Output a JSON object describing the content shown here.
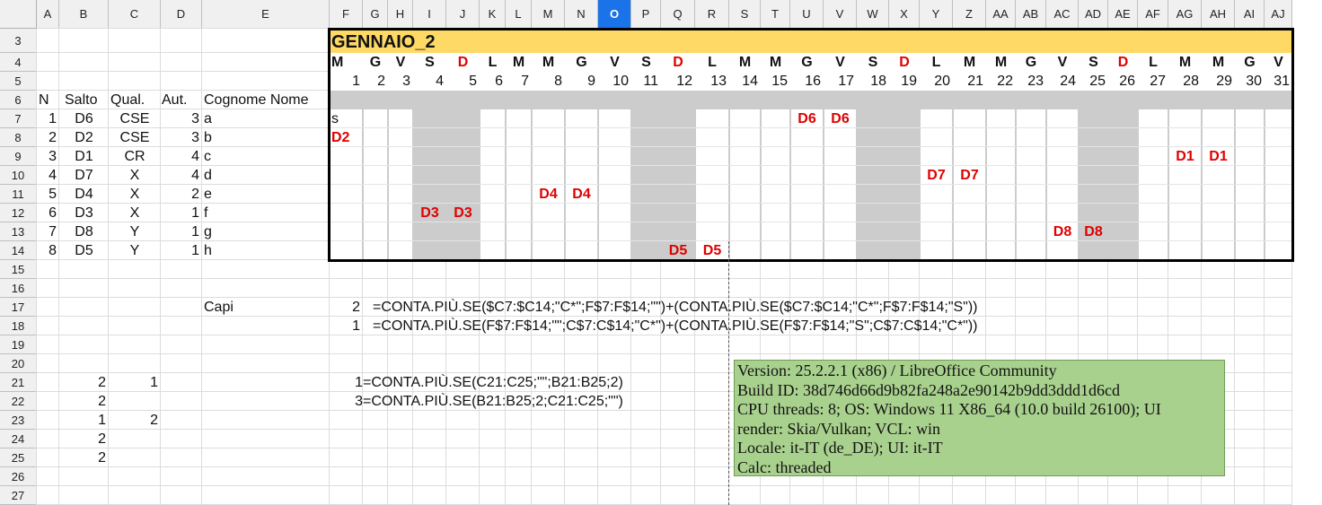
{
  "columns": [
    "A",
    "B",
    "C",
    "D",
    "E",
    "F",
    "G",
    "H",
    "I",
    "J",
    "K",
    "L",
    "M",
    "N",
    "O",
    "P",
    "Q",
    "R",
    "S",
    "T",
    "U",
    "V",
    "W",
    "X",
    "Y",
    "Z",
    "AA",
    "AB",
    "AC",
    "AD",
    "AE",
    "AF",
    "AG",
    "AH",
    "AI",
    "AJ"
  ],
  "selected_column": "O",
  "rows": [
    "3",
    "4",
    "5",
    "6",
    "7",
    "8",
    "9",
    "10",
    "11",
    "12",
    "13",
    "14",
    "15",
    "16",
    "17",
    "18",
    "19",
    "20",
    "21",
    "22",
    "23",
    "24",
    "25",
    "26",
    "27"
  ],
  "calendar": {
    "title": "GENNAIO_2",
    "weekdays": [
      "M",
      "G",
      "V",
      "S",
      "D",
      "L",
      "M",
      "M",
      "G",
      "V",
      "S",
      "D",
      "L",
      "M",
      "M",
      "G",
      "V",
      "S",
      "D",
      "L",
      "M",
      "M",
      "G",
      "V",
      "S",
      "D",
      "L",
      "M",
      "M",
      "G",
      "V"
    ],
    "days": [
      "1",
      "2",
      "3",
      "4",
      "5",
      "6",
      "7",
      "8",
      "9",
      "10",
      "11",
      "12",
      "13",
      "14",
      "15",
      "16",
      "17",
      "18",
      "19",
      "20",
      "21",
      "22",
      "23",
      "24",
      "25",
      "26",
      "27",
      "28",
      "29",
      "30",
      "31"
    ],
    "sunday_color": "#e00000",
    "header_color": "#ffd966",
    "band_color": "#cccccc"
  },
  "table": {
    "headers": {
      "n": "N",
      "salto": "Salto",
      "qual": "Qual.",
      "aut": "Aut.",
      "name": "Cognome Nome"
    },
    "rows": [
      {
        "n": "1",
        "salto": "D6",
        "qual": "CSE",
        "aut": "3",
        "name": "a"
      },
      {
        "n": "2",
        "salto": "D2",
        "qual": "CSE",
        "aut": "3",
        "name": "b"
      },
      {
        "n": "3",
        "salto": "D1",
        "qual": "CR",
        "aut": "4",
        "name": "c"
      },
      {
        "n": "4",
        "salto": "D7",
        "qual": "X",
        "aut": "4",
        "name": "d"
      },
      {
        "n": "5",
        "salto": "D4",
        "qual": "X",
        "aut": "2",
        "name": "e"
      },
      {
        "n": "6",
        "salto": "D3",
        "qual": "X",
        "aut": "1",
        "name": "f"
      },
      {
        "n": "7",
        "salto": "D8",
        "qual": "Y",
        "aut": "1",
        "name": "g"
      },
      {
        "n": "8",
        "salto": "D5",
        "qual": "Y",
        "aut": "1",
        "name": "h"
      }
    ]
  },
  "assignments": [
    {
      "row": 7,
      "col": "F",
      "text": "s",
      "red": false
    },
    {
      "row": 7,
      "col": "U",
      "text": "D6",
      "red": true
    },
    {
      "row": 7,
      "col": "V",
      "text": "D6",
      "red": true
    },
    {
      "row": 8,
      "col": "F",
      "text": "D2",
      "red": true
    },
    {
      "row": 9,
      "col": "AG",
      "text": "D1",
      "red": true
    },
    {
      "row": 9,
      "col": "AH",
      "text": "D1",
      "red": true
    },
    {
      "row": 10,
      "col": "Y",
      "text": "D7",
      "red": true
    },
    {
      "row": 10,
      "col": "Z",
      "text": "D7",
      "red": true
    },
    {
      "row": 11,
      "col": "M",
      "text": "D4",
      "red": true
    },
    {
      "row": 11,
      "col": "N",
      "text": "D4",
      "red": true
    },
    {
      "row": 12,
      "col": "I",
      "text": "D3",
      "red": true
    },
    {
      "row": 12,
      "col": "J",
      "text": "D3",
      "red": true
    },
    {
      "row": 13,
      "col": "AC",
      "text": "D8",
      "red": true
    },
    {
      "row": 13,
      "col": "AD",
      "text": "D8",
      "red": true
    },
    {
      "row": 14,
      "col": "Q",
      "text": "D5",
      "red": true
    },
    {
      "row": 14,
      "col": "R",
      "text": "D5",
      "red": true
    }
  ],
  "capi": {
    "label": "Capi",
    "value1": "2",
    "formula1": "=CONTA.PIÙ.SE($C7:$C14;\"C*\";F$7:F$14;\"\")+(CONTA.PIÙ.SE($C7:$C14;\"C*\";F$7:F$14;\"S\"))",
    "value2": "1",
    "formula2": "=CONTA.PIÙ.SE(F$7:F$14;\"\";C$7:C$14;\"C*\")+(CONTA.PIÙ.SE(F$7:F$14;\"S\";C$7:C$14;\"C*\"))"
  },
  "lower": {
    "b": [
      "2",
      "2",
      "1",
      "2",
      "2"
    ],
    "c21": "1",
    "c23": "2",
    "f21": "1",
    "g21": "=CONTA.PIÙ.SE(C21:C25;\"\";B21:B25;2)",
    "f22": "3",
    "g22": "=CONTA.PIÙ.SE(B21:B25;2;C21:C25;\"\")"
  },
  "info": [
    "Version: 25.2.2.1 (x86) / LibreOffice Community",
    "Build ID: 38d746d66d9b82fa248a2e90142b9dd3ddd1d6cd",
    "CPU threads: 8; OS: Windows 11 X86_64 (10.0 build 26100); UI",
    "render: Skia/Vulkan; VCL: win",
    "Locale: it-IT (de_DE); UI: it-IT",
    "Calc: threaded"
  ],
  "info_color": "#a9d18e"
}
